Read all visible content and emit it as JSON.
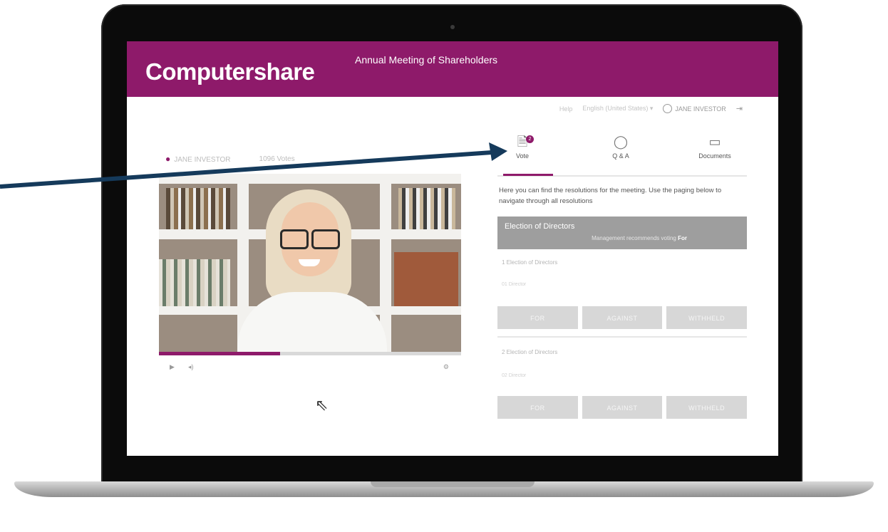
{
  "app": {
    "logo_text": "Computershare",
    "meeting_title": "Annual Meeting of Shareholders"
  },
  "topbar": {
    "help": "Help",
    "language": "English (United States) ▾",
    "user": "JANE INVESTOR"
  },
  "viewer": {
    "name": "JANE INVESTOR",
    "votes": "1096 Votes"
  },
  "video": {
    "progress": 0.4
  },
  "tabs": [
    {
      "label": "Vote",
      "badge": "2"
    },
    {
      "label": "Q & A"
    },
    {
      "label": "Documents"
    }
  ],
  "intro": "Here you can find the resolutions for the meeting. Use the paging below to navigate through all resolutions",
  "section": {
    "title": "Election of Directors",
    "recommend_prefix": "Management recommends voting",
    "recommend_value": "For"
  },
  "resolutions": [
    {
      "title": "1 Election of Directors",
      "sub": "01 Director",
      "buttons": [
        "FOR",
        "AGAINST",
        "WITHHELD"
      ]
    },
    {
      "title": "2 Election of Directors",
      "sub": "02 Director",
      "buttons": [
        "FOR",
        "AGAINST",
        "WITHHELD"
      ]
    }
  ],
  "colors": {
    "brand": "#8e1a6a",
    "arrow": "#153a5b"
  }
}
